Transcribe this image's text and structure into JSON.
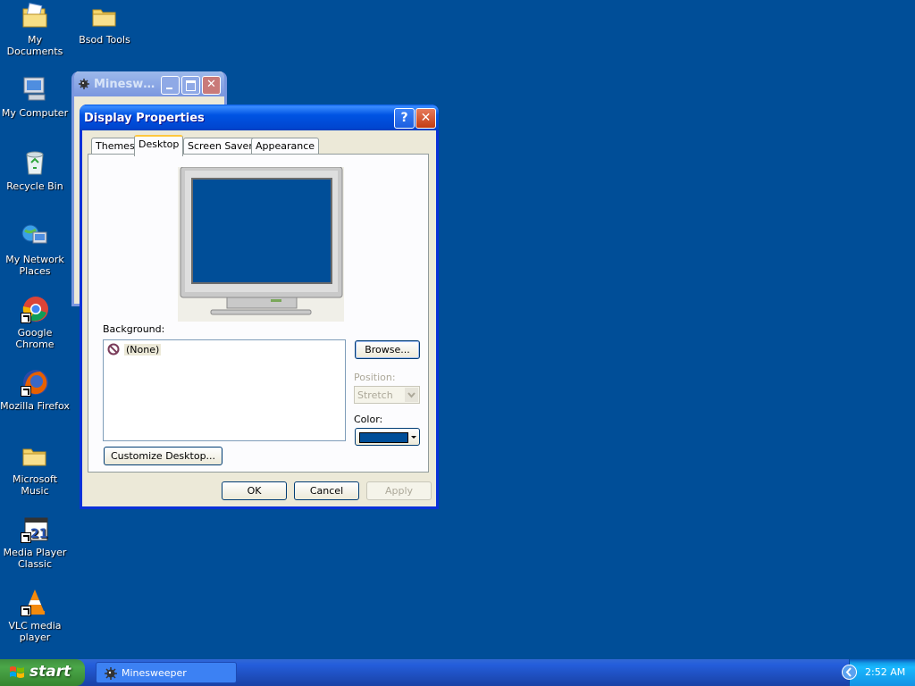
{
  "desktop": {
    "icons": [
      {
        "label": "My Documents",
        "icon": "my-documents-icon"
      },
      {
        "label": "Bsod Tools",
        "icon": "folder-icon"
      },
      {
        "label": "My Computer",
        "icon": "my-computer-icon"
      },
      {
        "label": "Recycle Bin",
        "icon": "recycle-bin-icon"
      },
      {
        "label": "My Network Places",
        "icon": "network-places-icon"
      },
      {
        "label": "Google Chrome",
        "icon": "chrome-icon"
      },
      {
        "label": "Mozilla Firefox",
        "icon": "firefox-icon"
      },
      {
        "label": "Microsoft Music",
        "icon": "folder-icon"
      },
      {
        "label": "Media Player Classic",
        "icon": "media-player-icon"
      },
      {
        "label": "VLC media player",
        "icon": "vlc-icon"
      }
    ]
  },
  "minesweeper_window": {
    "title": "Minesweeper"
  },
  "dialog": {
    "title": "Display Properties",
    "help_label": "?",
    "close_label": "✕",
    "tabs": [
      "Themes",
      "Desktop",
      "Screen Saver",
      "Appearance"
    ],
    "active_tab": "Desktop",
    "background_label": "Background:",
    "background_items": [
      "(None)"
    ],
    "browse_label": "Browse...",
    "position_label": "Position:",
    "position_value": "Stretch",
    "color_label": "Color:",
    "color_value": "#004e98",
    "customize_label": "Customize Desktop...",
    "ok_label": "OK",
    "cancel_label": "Cancel",
    "apply_label": "Apply"
  },
  "taskbar": {
    "start_label": "start",
    "tasks": [
      {
        "label": "Minesweeper",
        "icon": "minesweeper-icon"
      }
    ],
    "clock": "2:52 AM"
  }
}
